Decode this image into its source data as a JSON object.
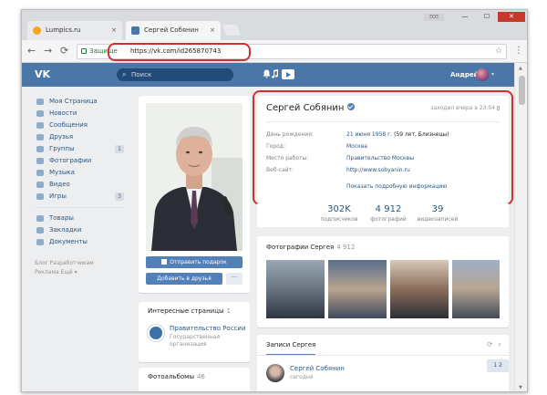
{
  "browser": {
    "tabs": [
      {
        "label": "Lumpics.ru",
        "favicon_color": "#f5a623",
        "close": "×"
      },
      {
        "label": "Сергей Собянин",
        "favicon_color": "#4a76a8",
        "close": "×"
      }
    ],
    "window_buttons": {
      "minimize": "—",
      "maximize": "☐",
      "close": "✕"
    },
    "profile_label": "ΞΟΞ",
    "back": "←",
    "forward": "→",
    "reload": "⟳",
    "secure_label": "Защище",
    "url": "https://vk.com/id265870743",
    "star": "☆",
    "menu": "⋮"
  },
  "vk": {
    "logo": "VK",
    "search": {
      "icon": "⌕",
      "placeholder": "Поиск"
    },
    "header_icons": {
      "bell": "🔔",
      "music": "♫"
    },
    "user": {
      "name": "Андрей",
      "chevron": "▾"
    },
    "menu": [
      {
        "label": "Моя Страница",
        "count": ""
      },
      {
        "label": "Новости",
        "count": ""
      },
      {
        "label": "Сообщения",
        "count": ""
      },
      {
        "label": "Друзья",
        "count": ""
      },
      {
        "label": "Группы",
        "count": "1"
      },
      {
        "label": "Фотографии",
        "count": ""
      },
      {
        "label": "Музыка",
        "count": ""
      },
      {
        "label": "Видео",
        "count": ""
      },
      {
        "label": "Игры",
        "count": "3"
      }
    ],
    "menu2": [
      {
        "label": "Товары"
      },
      {
        "label": "Закладки"
      },
      {
        "label": "Документы"
      }
    ],
    "footer": {
      "line1": "Блог   Разработчикам",
      "line2": "Реклама   Ещё ▾"
    }
  },
  "profile": {
    "gift_button": "Отправить подарок",
    "friend_button": "Добавить в друзья",
    "more_button": "···",
    "pages": {
      "title": "Интересные страницы",
      "count": "1",
      "name": "Правительство России",
      "sub": "Государственная организация"
    },
    "albums": {
      "title": "Фотоальбомы",
      "count": "46"
    },
    "name": "Сергей Собянин",
    "online": "заходил вчера в 23:04",
    "info": [
      {
        "label": "День рождения:",
        "value": "21 июня 1958 г.",
        "extra": " (59 лет, Близнецы)"
      },
      {
        "label": "Город:",
        "value": "Москва",
        "extra": ""
      },
      {
        "label": "Место работы:",
        "value": "Правительство Москвы",
        "extra": ""
      },
      {
        "label": "Веб-сайт:",
        "value": "http://www.sobyanin.ru",
        "extra": ""
      }
    ],
    "show_more": "Показать подробную информацию",
    "counters": [
      {
        "num": "302K",
        "label": "подписчиков"
      },
      {
        "num": "4 912",
        "label": "фотографий"
      },
      {
        "num": "39",
        "label": "видеозаписей"
      }
    ],
    "photos": {
      "title": "Фотографии Сергея",
      "count": "4 912"
    },
    "posts": {
      "tab": "Записи Сергея",
      "author": "Сергей Собянин",
      "date": "сегодня",
      "page": "1 2"
    }
  }
}
